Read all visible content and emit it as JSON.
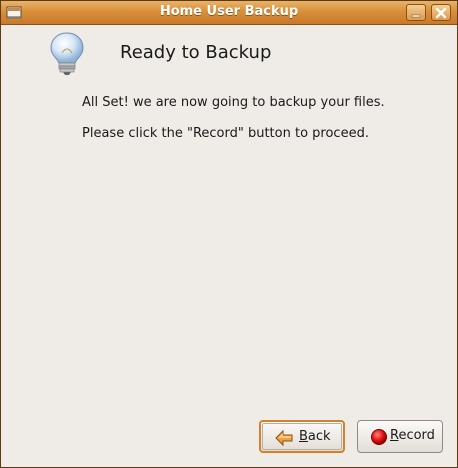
{
  "window": {
    "title": "Home User Backup"
  },
  "content": {
    "heading": "Ready to Backup",
    "line1": "All Set! we are now going to backup your files.",
    "line2": "Please click the \"Record\" button to proceed."
  },
  "buttons": {
    "back": {
      "mnemonic": "B",
      "rest": "ack"
    },
    "record": {
      "mnemonic": "R",
      "rest": "ecord"
    }
  },
  "colors": {
    "titlebar": "#d98f3a",
    "background": "#efebe7",
    "focus_ring": "#d3822c",
    "record_dot": "#e01010"
  },
  "icons": [
    "window-menu-icon",
    "minimize-icon",
    "close-icon",
    "lightbulb-icon",
    "back-arrow-icon",
    "record-icon"
  ]
}
